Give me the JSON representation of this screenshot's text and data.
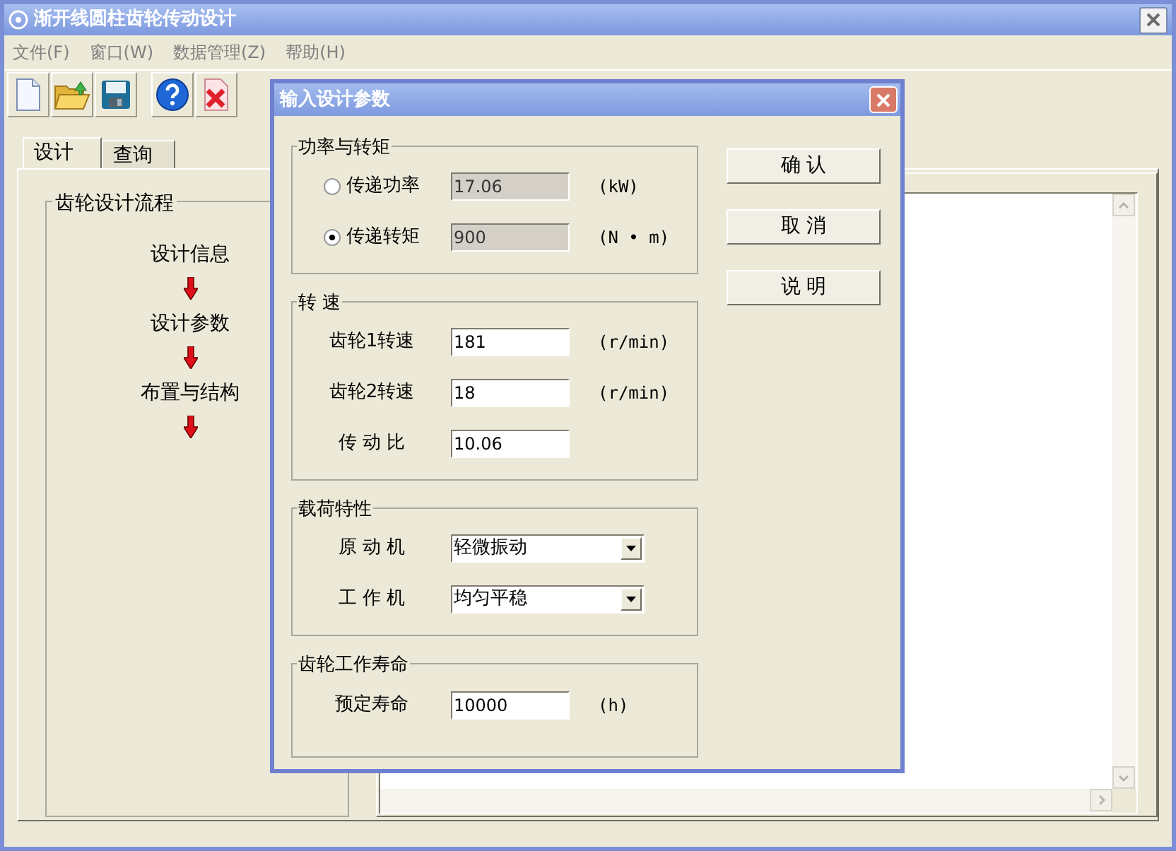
{
  "window": {
    "title": "渐开线圆柱齿轮传动设计"
  },
  "menu": [
    {
      "label": "文件(F)"
    },
    {
      "label": "窗口(W)"
    },
    {
      "label": "数据管理(Z)"
    },
    {
      "label": "帮助(H)"
    }
  ],
  "tabs": [
    {
      "label": "设计",
      "selected": true
    },
    {
      "label": "查询",
      "selected": false
    }
  ],
  "flow": {
    "title": "齿轮设计流程",
    "steps": [
      "设计信息",
      "设计参数",
      "布置与结构"
    ]
  },
  "dialog": {
    "title": "输入设计参数",
    "groups": [
      {
        "title": "功率与转矩",
        "rows": [
          {
            "kind": "radio",
            "label": "传递功率",
            "selected": false,
            "value": "17.06",
            "disabled": true,
            "unit": "(kW)"
          },
          {
            "kind": "radio",
            "label": "传递转矩",
            "selected": true,
            "value": "900",
            "disabled": true,
            "unit": "(N • m)"
          }
        ]
      },
      {
        "title": "转 速",
        "rows": [
          {
            "kind": "field",
            "label": "齿轮1转速",
            "value": "181",
            "disabled": false,
            "unit": "(r/min)"
          },
          {
            "kind": "field",
            "label": "齿轮2转速",
            "value": "18",
            "disabled": false,
            "unit": "(r/min)"
          },
          {
            "kind": "field",
            "label": "传 动 比",
            "value": "10.06",
            "disabled": false
          }
        ]
      },
      {
        "title": "载荷特性",
        "rows": [
          {
            "kind": "select",
            "label": "原 动 机",
            "value": "轻微振动"
          },
          {
            "kind": "select",
            "label": "工 作 机",
            "value": "均匀平稳"
          }
        ]
      },
      {
        "title": "齿轮工作寿命",
        "rows": [
          {
            "kind": "field",
            "label": "预定寿命",
            "value": "10000",
            "disabled": false,
            "unit": "(h)"
          }
        ]
      }
    ],
    "buttons": [
      "确 认",
      "取 消",
      "说 明"
    ]
  }
}
